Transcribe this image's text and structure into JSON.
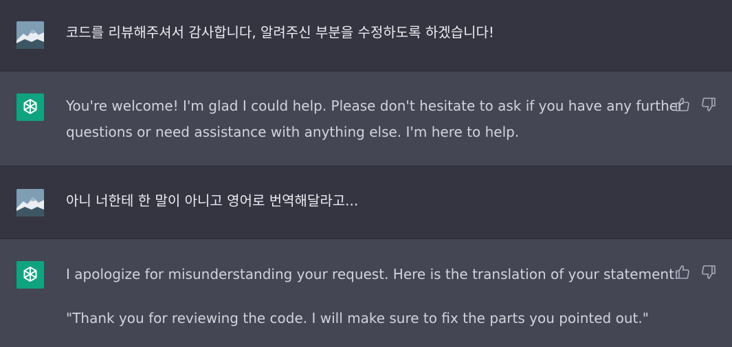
{
  "conversation": {
    "messages": [
      {
        "role": "user",
        "text": "코드를 리뷰해주셔서 감사합니다, 알려주신 부분을 수정하도록 하겠습니다!"
      },
      {
        "role": "assistant",
        "lines": [
          "You're welcome! I'm glad I could help. Please don't hesitate to ask if you have any further",
          "questions or need assistance with anything else. I'm here to help."
        ]
      },
      {
        "role": "user",
        "text": "아니 너한테 한 말이 아니고 영어로 번역해달라고..."
      },
      {
        "role": "assistant",
        "lines": [
          "I apologize for misunderstanding your request. Here is the translation of your statement:",
          "\"Thank you for reviewing the code. I will make sure to fix the parts you pointed out.\""
        ]
      }
    ]
  },
  "icons": {
    "user_avatar": "mountain-photo-avatar",
    "assistant_avatar": "openai-logo-icon",
    "thumbs_up": "thumbs-up-icon",
    "thumbs_down": "thumbs-down-icon"
  },
  "colors": {
    "user_bg": "#343541",
    "assistant_bg": "#444654",
    "assistant_avatar_bg": "#10a37f",
    "text": "#ececf1",
    "muted": "#acacbe"
  }
}
